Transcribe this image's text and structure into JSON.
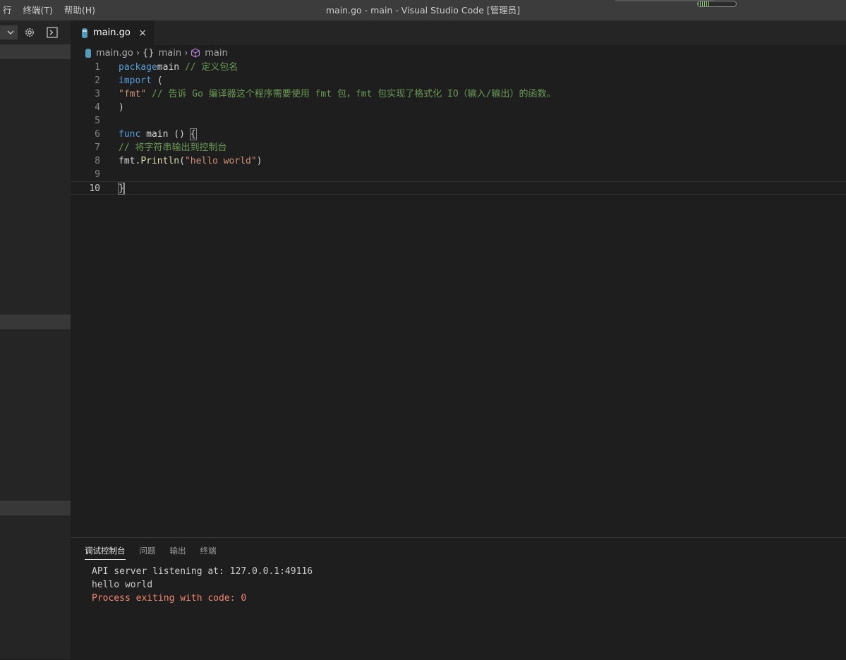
{
  "menu": {
    "items": [
      "行",
      "终端(T)",
      "帮助(H)"
    ]
  },
  "window": {
    "title": "main.go - main - Visual Studio Code [管理员]"
  },
  "sidebar": {
    "dropdown_icon": "chevron-down-icon",
    "gear_icon": "gear-icon",
    "console_icon": "debug-console-icon"
  },
  "tab": {
    "label": "main.go",
    "close": "×"
  },
  "breadcrumb": {
    "file": "main.go",
    "package_symbol": "{}",
    "package": "main",
    "function": "main"
  },
  "editor": {
    "lines": [
      {
        "number": "1",
        "tokens": [
          [
            "kw",
            "package"
          ],
          [
            "",
            "main "
          ],
          [
            "cm",
            "// 定义包名"
          ]
        ]
      },
      {
        "number": "2",
        "tokens": [
          [
            "kw",
            "import"
          ],
          [
            "",
            " ("
          ]
        ]
      },
      {
        "number": "3",
        "tokens": [
          [
            "str",
            "\"fmt\""
          ],
          [
            "cm",
            " // 告诉 Go 编译器这个程序需要使用 fmt 包，fmt 包实现了格式化 IO（输入/输出）的函数。"
          ]
        ]
      },
      {
        "number": "4",
        "tokens": [
          [
            "",
            ")"
          ]
        ]
      },
      {
        "number": "5",
        "tokens": []
      },
      {
        "number": "6",
        "tokens": [
          [
            "kw",
            "func"
          ],
          [
            "",
            " main () "
          ],
          [
            "brk",
            "{"
          ]
        ]
      },
      {
        "number": "7",
        "tokens": [
          [
            "cm",
            "// 将字符串输出到控制台"
          ]
        ]
      },
      {
        "number": "8",
        "tokens": [
          [
            "",
            "fmt."
          ],
          [
            "fn",
            "Println"
          ],
          [
            "",
            "("
          ],
          [
            "str",
            "\"hello world\""
          ],
          [
            "",
            ")"
          ]
        ]
      },
      {
        "number": "9",
        "tokens": []
      },
      {
        "number": "10",
        "tokens": [
          [
            "brk",
            "}"
          ]
        ]
      }
    ]
  },
  "panel": {
    "tabs": [
      "调试控制台",
      "问题",
      "输出",
      "终端"
    ],
    "console": [
      {
        "text": "API server listening at: 127.0.0.1:49116",
        "kind": "normal"
      },
      {
        "text": "hello world",
        "kind": "normal"
      },
      {
        "text": "Process exiting with code: 0",
        "kind": "err"
      }
    ]
  },
  "colors": {
    "keyword": "#569cd6",
    "comment": "#6a9955",
    "string": "#ce9178",
    "function": "#dcdcaa",
    "error": "#f48771",
    "go_blue": "#519aba",
    "symbol_purple": "#b180d7"
  }
}
